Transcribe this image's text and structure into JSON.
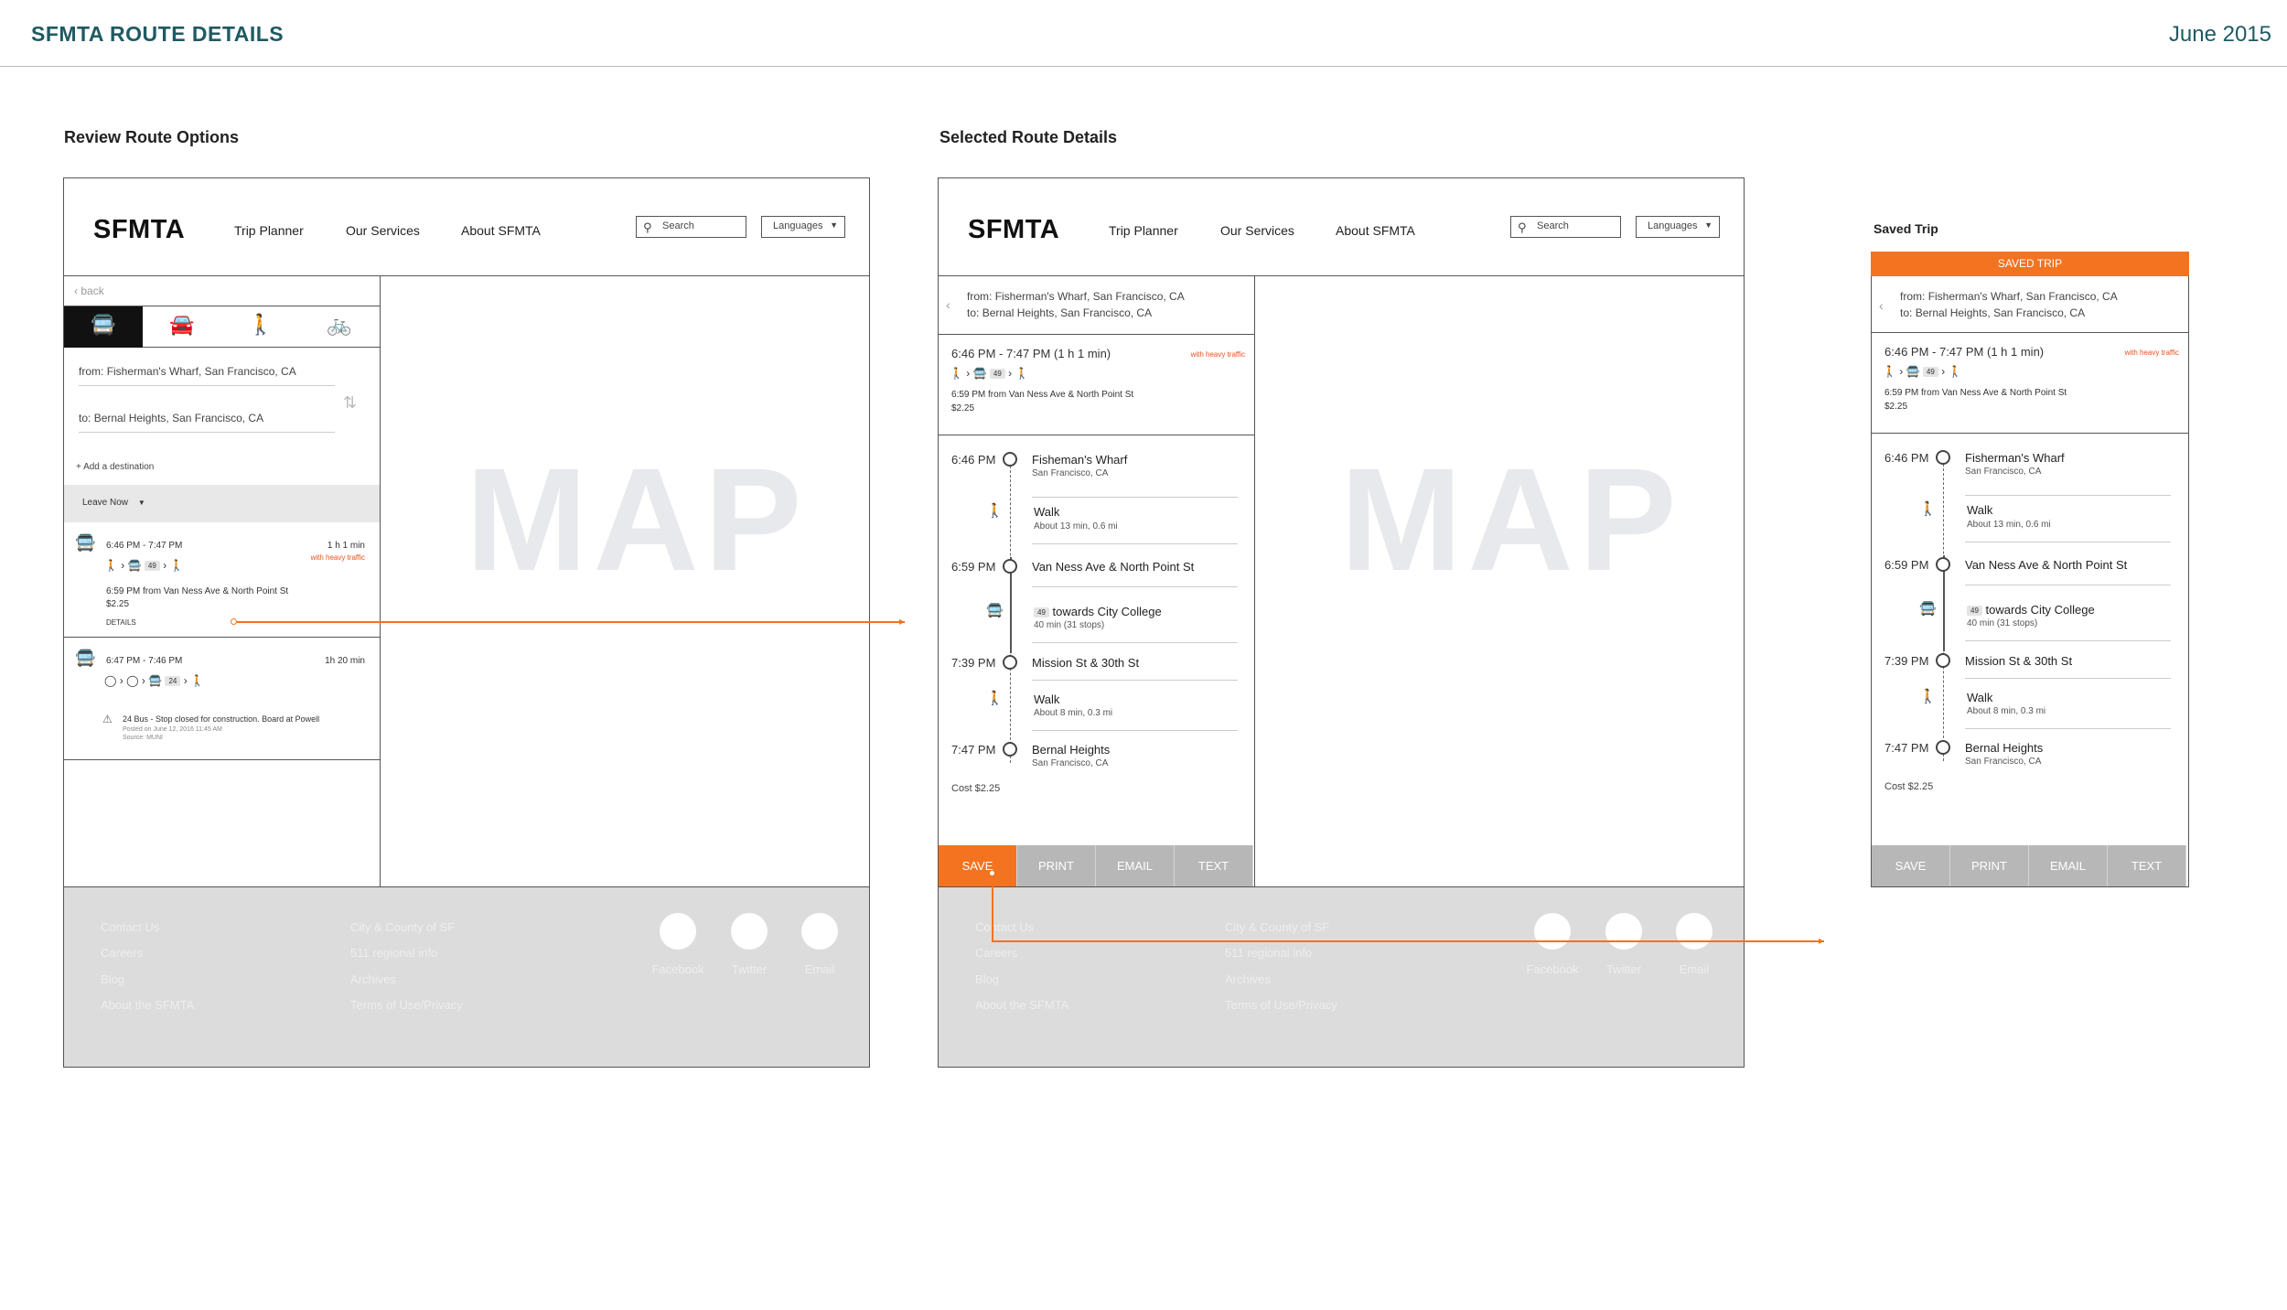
{
  "header": {
    "title": "SFMTA ROUTE DETAILS",
    "date": "June 2015"
  },
  "sections": {
    "review": "Review Route Options",
    "selected": "Selected Route Details",
    "saved": "Saved Trip"
  },
  "site": {
    "logo": "SFMTA",
    "nav": [
      "Trip Planner",
      "Our Services",
      "About SFMTA"
    ],
    "search_placeholder": "Search",
    "languages": "Languages",
    "map_label": "MAP"
  },
  "footer": {
    "col1": [
      "Contact Us",
      "Careers",
      "Blog",
      "About the SFMTA"
    ],
    "col2": [
      "City & County of SF",
      "511 regional info",
      "Archives",
      "Terms of Use/Privacy"
    ],
    "social": [
      "Facebook",
      "Twitter",
      "Email"
    ]
  },
  "review": {
    "back": "back",
    "from_label": "from:",
    "from": "Fisherman's Wharf, San Francisco, CA",
    "to_label": "to:",
    "to": "Bernal Heights, San Francisco, CA",
    "add_destination": "+ Add a destination",
    "leave": "Leave Now",
    "options": [
      {
        "time": "6:46 PM - 7:47 PM",
        "duration": "1 h 1 min",
        "traffic": "with heavy traffic",
        "bus": "49",
        "departure": "6:59 PM from Van Ness Ave & North Point St",
        "cost": "$2.25",
        "details": "DETAILS"
      },
      {
        "time": "6:47 PM - 7:46 PM",
        "duration": "1h 20 min",
        "bus": "24",
        "alert": "24 Bus - Stop closed for construction. Board at Powell",
        "posted": "Posted on June 12, 2016  11:45 AM",
        "source": "Source: MUNI"
      }
    ]
  },
  "details": {
    "from_label": "from:",
    "from": "Fisherman's Wharf, San Francisco, CA",
    "to_label": "to:",
    "to": "Bernal Heights, San Francisco, CA",
    "time": "6:46 PM - 7:47 PM (1 h 1 min)",
    "traffic": "with heavy traffic",
    "bus": "49",
    "departure": "6:59 PM from Van Ness Ave & North Point St",
    "cost": "$2.25",
    "stops": [
      {
        "time": "6:46 PM",
        "name": "Fisheman's Wharf",
        "sub": "San Francisco, CA"
      },
      {
        "time": "6:59 PM",
        "name": "Van Ness Ave & North Point St"
      },
      {
        "time": "7:39 PM",
        "name": "Mission St & 30th St"
      },
      {
        "time": "7:47 PM",
        "name": "Bernal Heights",
        "sub": "San Francisco, CA"
      }
    ],
    "legs": [
      {
        "title": "Walk",
        "sub": "About 13 min, 0.6 mi"
      },
      {
        "badge": "49",
        "title": "towards City College",
        "sub": "40 min (31 stops)"
      },
      {
        "title": "Walk",
        "sub": "About 8 min, 0.3 mi"
      }
    ],
    "cost_label": "Cost $2.25",
    "actions": [
      "SAVE",
      "PRINT",
      "EMAIL",
      "TEXT"
    ]
  },
  "saved": {
    "banner": "SAVED TRIP",
    "first_stop": "Fisherman's Wharf"
  }
}
